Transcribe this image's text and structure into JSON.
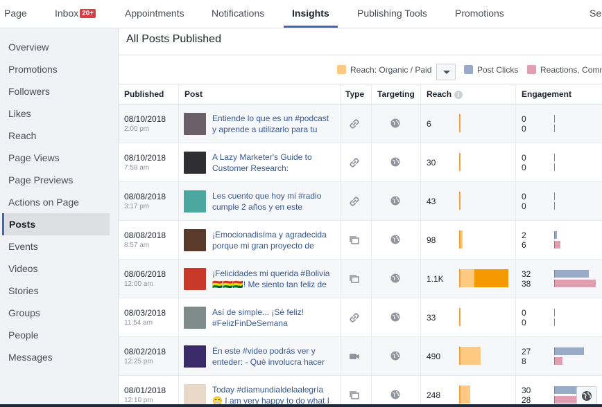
{
  "topnav": {
    "tabs": [
      {
        "label": "Page"
      },
      {
        "label": "Inbox",
        "badge": "20+"
      },
      {
        "label": "Appointments"
      },
      {
        "label": "Notifications"
      },
      {
        "label": "Insights",
        "active": true
      },
      {
        "label": "Publishing Tools"
      },
      {
        "label": "Promotions"
      },
      {
        "label": "Se"
      }
    ]
  },
  "sidebar": {
    "items": [
      {
        "label": "Overview"
      },
      {
        "label": "Promotions"
      },
      {
        "label": "Followers"
      },
      {
        "label": "Likes"
      },
      {
        "label": "Reach"
      },
      {
        "label": "Page Views"
      },
      {
        "label": "Page Previews"
      },
      {
        "label": "Actions on Page"
      },
      {
        "label": "Posts",
        "active": true
      },
      {
        "label": "Events"
      },
      {
        "label": "Videos"
      },
      {
        "label": "Stories"
      },
      {
        "label": "Groups"
      },
      {
        "label": "People"
      },
      {
        "label": "Messages"
      }
    ]
  },
  "main": {
    "title": "All Posts Published",
    "legend": {
      "reach": "Reach: Organic / Paid",
      "post_clicks": "Post Clicks",
      "reactions": "Reactions, Comments & Shares"
    },
    "columns": {
      "published": "Published",
      "post": "Post",
      "type": "Type",
      "targeting": "Targeting",
      "reach": "Reach",
      "engagement": "Engagement"
    },
    "rows": [
      {
        "date": "08/10/2018",
        "time": "2:00 pm",
        "line1": "Entiende lo que es un #podcast",
        "line2": "y aprende a utilizarlo para tu",
        "type": "link",
        "reach": "6",
        "organic_pct": 0.004,
        "paid_pct": 0,
        "clicks": "0",
        "reactions": "0",
        "clicks_pct": 0,
        "react_pct": 0,
        "thumb": "#6b5f6a"
      },
      {
        "date": "08/10/2018",
        "time": "7:58 am",
        "line1": "A Lazy Marketer's Guide to",
        "line2": "Customer Research:",
        "type": "link",
        "reach": "30",
        "organic_pct": 0.02,
        "paid_pct": 0,
        "clicks": "0",
        "reactions": "0",
        "clicks_pct": 0,
        "react_pct": 0,
        "thumb": "#2f2f33"
      },
      {
        "date": "08/08/2018",
        "time": "3:17 pm",
        "line1": "Les cuento que hoy mi #radio",
        "line2": "cumple 2 años y en este",
        "type": "link",
        "reach": "43",
        "organic_pct": 0.03,
        "paid_pct": 0,
        "clicks": "0",
        "reactions": "0",
        "clicks_pct": 0,
        "react_pct": 0,
        "thumb": "#4aa8a0"
      },
      {
        "date": "08/08/2018",
        "time": "8:57 am",
        "line1": "¡Emocionadisíma y agradecida",
        "line2": "porque mi gran proyecto de",
        "type": "album",
        "reach": "98",
        "organic_pct": 0.07,
        "paid_pct": 0,
        "clicks": "2",
        "reactions": "6",
        "clicks_pct": 0.06,
        "react_pct": 0.15,
        "thumb": "#5a3a2a"
      },
      {
        "date": "08/06/2018",
        "time": "12:00 am",
        "line1": "¡Felicidades mi querida #Bolivia",
        "line2": "🇧🇴🇧🇴🇧🇴! Me siento tan feliz de",
        "type": "album",
        "reach": "1.1K",
        "organic_pct": 0.31,
        "paid_pct": 0.69,
        "clicks": "32",
        "reactions": "38",
        "clicks_pct": 0.84,
        "react_pct": 1.0,
        "thumb": "#c8392a"
      },
      {
        "date": "08/03/2018",
        "time": "11:54 am",
        "line1": "Así de simple... ¡Sé feliz!",
        "line2": "#FelizFinDeSemana",
        "type": "link",
        "reach": "33",
        "organic_pct": 0.02,
        "paid_pct": 0,
        "clicks": "0",
        "reactions": "0",
        "clicks_pct": 0,
        "react_pct": 0,
        "thumb": "#7d8c88"
      },
      {
        "date": "08/02/2018",
        "time": "12:25 pm",
        "line1": "En este #video podrás ver y",
        "line2": "enteder: - Què involucra hacer",
        "type": "video",
        "reach": "490",
        "organic_pct": 0.44,
        "paid_pct": 0,
        "clicks": "27",
        "reactions": "8",
        "clicks_pct": 0.71,
        "react_pct": 0.2,
        "thumb": "#3a2a6a"
      },
      {
        "date": "08/01/2018",
        "time": "12:10 pm",
        "line1": "Today #díamundialdelaalegría",
        "line2": "😁 I am very happy to do what I",
        "type": "album",
        "reach": "248",
        "organic_pct": 0.22,
        "paid_pct": 0,
        "clicks": "30",
        "reactions": "28",
        "clicks_pct": 0.79,
        "react_pct": 0.74,
        "thumb": "#e8d8c8"
      }
    ]
  },
  "colors": {
    "accent": "#4267b2",
    "organic": "#fec981",
    "paid": "#f49a00",
    "post_clicks": "#99a9c8",
    "reactions": "#e09fb0"
  }
}
